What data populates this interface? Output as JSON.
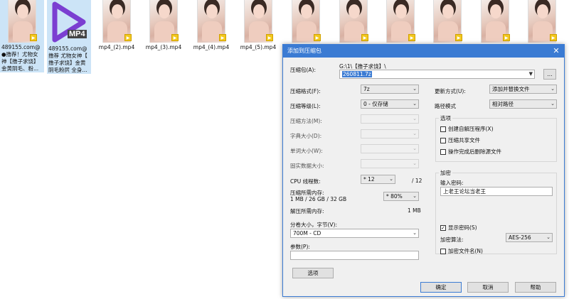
{
  "explorer": {
    "files": [
      {
        "name": "489155.com@ ●撸荐！尤物女神【撸子求饶】金黄阴毛、粉...",
        "badge": "Play"
      },
      {
        "name": "489155.com@ 撸荐 尤物女神【 撸子求饶】金黄 阴毛粉屄 全身...",
        "icon_label": "MP4"
      },
      {
        "name": "mp4_(2).mp4",
        "badge": "Play"
      },
      {
        "name": "mp4_(3).mp4",
        "badge": "Play"
      },
      {
        "name": "mp4_(4).mp4",
        "badge": "Play"
      },
      {
        "name": "mp4_(5).mp4",
        "badge": "Play"
      },
      {
        "name": "",
        "badge": "Play"
      },
      {
        "name": "",
        "badge": "Play"
      },
      {
        "name": "",
        "badge": "Play"
      },
      {
        "name": "",
        "badge": "Play"
      },
      {
        "name": "",
        "badge": "Play"
      },
      {
        "name": "",
        "badge": "Play"
      }
    ]
  },
  "dialog": {
    "title": "添加到压缩包",
    "close": "✕",
    "archive_label": "压缩包(A):",
    "archive_path": "G:\\1\\【撸子求饶】\\",
    "archive_name": "260811.7z",
    "browse": "...",
    "format_label": "压缩格式(F):",
    "format_value": "7z",
    "level_label": "压缩等级(L):",
    "level_value": "0 - 仅存储",
    "method_label": "压缩方法(M):",
    "dict_label": "字典大小(D):",
    "word_label": "单词大小(W):",
    "solid_label": "固实数据大小:",
    "cpu_label": "CPU 线程数:",
    "cpu_value": "* 12",
    "cpu_max": "/ 12",
    "mem_compress_label": "压缩所需内存:",
    "mem_compress_value": "1 MB / 26 GB / 32 GB",
    "mem_percent": "* 80%",
    "mem_decompress_label": "解压所需内存:",
    "mem_decompress_value": "1 MB",
    "split_label": "分卷大小，字节(V):",
    "split_value": "700M - CD",
    "params_label": "参数(P):",
    "params_value": "",
    "options_btn": "选项",
    "update_label": "更新方式(U):",
    "update_value": "添加并替换文件",
    "pathmode_label": "路径模式",
    "pathmode_value": "相对路径",
    "options_group": "选项",
    "opt_sfx": "创建自解压程序(X)",
    "opt_shared": "压缩共享文件",
    "opt_delete": "操作完成后删除源文件",
    "encrypt_group": "加密",
    "password_label": "输入密码:",
    "password_value": "上老王论坛当老王",
    "show_password": "显示密码(S)",
    "enc_method_label": "加密算法:",
    "enc_method_value": "AES-256",
    "enc_names": "加密文件名(N)",
    "ok": "确定",
    "cancel": "取消",
    "help": "帮助"
  }
}
